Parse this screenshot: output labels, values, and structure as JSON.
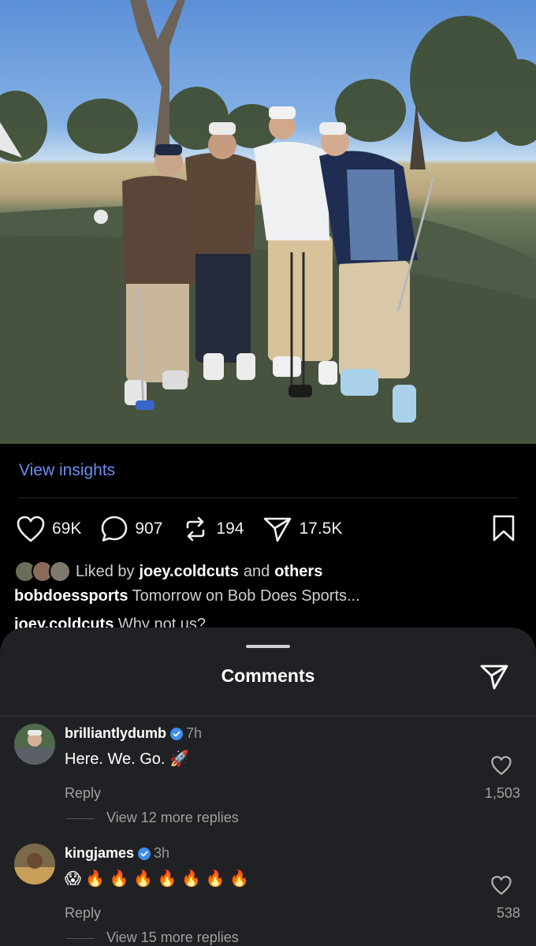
{
  "photo": {
    "description_icon": "photo"
  },
  "post": {
    "insights_label": "View insights",
    "likes": "69K",
    "comments": "907",
    "reposts": "194",
    "shares": "17.5K",
    "liked_by_prefix": "Liked by",
    "liked_by_user": "joey.coldcuts",
    "liked_by_and": "and",
    "liked_by_others": "others",
    "caption_user": "bobdoessports",
    "caption_text": "Tomorrow on Bob Does Sports...",
    "preview_user": "joey.coldcuts",
    "preview_text": "Why not us?"
  },
  "sheet": {
    "title": "Comments"
  },
  "comments": [
    {
      "user": "brilliantlydumb",
      "time": "7h",
      "text": "Here. We. Go. 🚀",
      "reply_label": "Reply",
      "more_replies": "View 12 more replies",
      "likes": "1,503"
    },
    {
      "user": "kingjames",
      "time": "3h",
      "text": "😱 🔥 🔥 🔥 🔥 🔥 🔥 🔥",
      "reply_label": "Reply",
      "more_replies": "View 15 more replies",
      "likes": "538"
    }
  ],
  "colors": {
    "link": "#6b8ef0",
    "sheet_bg": "#202124",
    "verified": "#3d8ef0"
  }
}
